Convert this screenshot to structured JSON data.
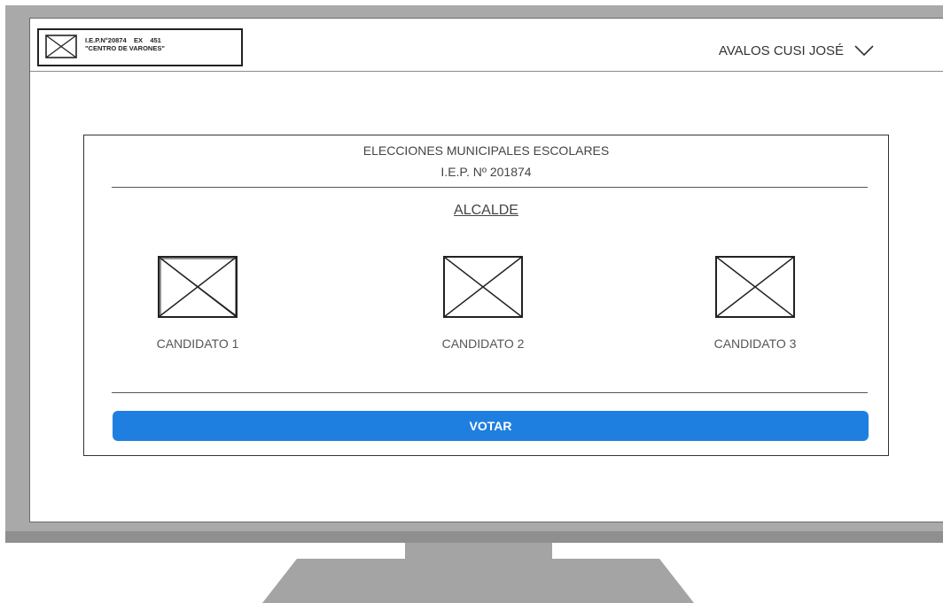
{
  "header": {
    "logo_line1": "I.E.P.N°20874    EX    451",
    "logo_line2": "\"CENTRO DE VARONES\"",
    "user_name": "AVALOS CUSI JOSÉ",
    "user_menu_icon": "chevron-down-icon"
  },
  "ballot": {
    "title": "ELECCIONES MUNICIPALES ESCOLARES",
    "subtitle": "I.E.P. Nº 201874",
    "office": "ALCALDE",
    "candidates": [
      {
        "label": "CANDIDATO 1",
        "icon": "image-placeholder-icon"
      },
      {
        "label": "CANDIDATO 2",
        "icon": "image-placeholder-icon"
      },
      {
        "label": "CANDIDATO 3",
        "icon": "image-placeholder-icon"
      }
    ],
    "vote_button": "VOTAR"
  },
  "colors": {
    "vote_button": "#1f7fe0",
    "bezel": "#a9a9a9"
  }
}
